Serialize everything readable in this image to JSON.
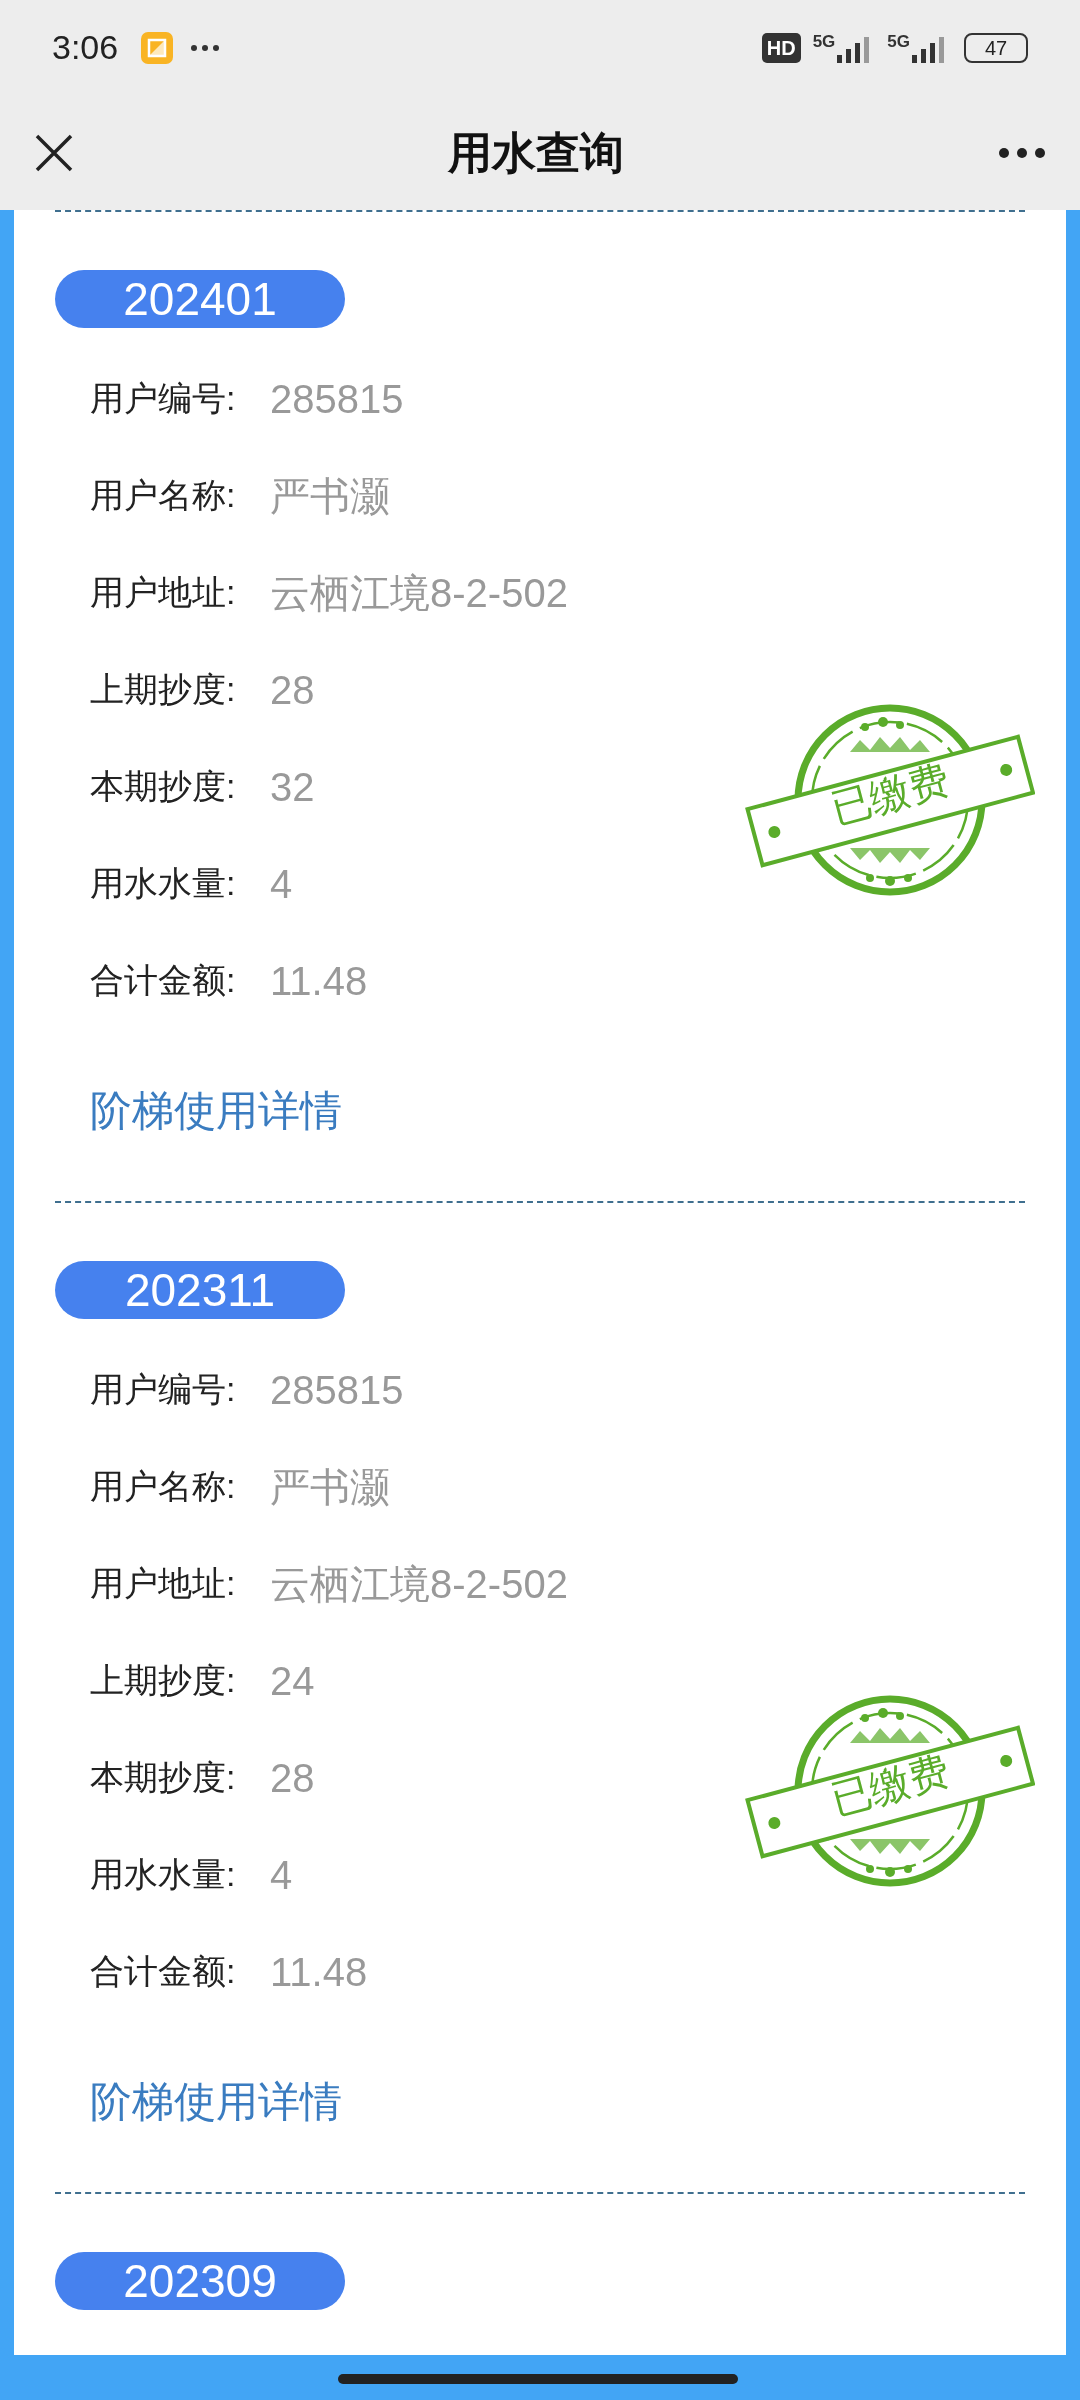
{
  "status_bar": {
    "time": "3:06",
    "hd": "HD",
    "networks": [
      "5G",
      "5G"
    ],
    "battery": "47"
  },
  "header": {
    "title": "用水查询"
  },
  "records": [
    {
      "period": "202401",
      "paid": true,
      "stamp": "已缴费",
      "fields": [
        {
          "label": "用户编号:",
          "value": "285815"
        },
        {
          "label": "用户名称:",
          "value": "严书灏"
        },
        {
          "label": "用户地址:",
          "value": "云栖江境8-2-502"
        },
        {
          "label": "上期抄度:",
          "value": "28"
        },
        {
          "label": "本期抄度:",
          "value": "32"
        },
        {
          "label": "用水水量:",
          "value": "4"
        },
        {
          "label": "合计金额:",
          "value": "11.48"
        }
      ],
      "link": "阶梯使用详情"
    },
    {
      "period": "202311",
      "paid": true,
      "stamp": "已缴费",
      "fields": [
        {
          "label": "用户编号:",
          "value": "285815"
        },
        {
          "label": "用户名称:",
          "value": "严书灏"
        },
        {
          "label": "用户地址:",
          "value": "云栖江境8-2-502"
        },
        {
          "label": "上期抄度:",
          "value": "24"
        },
        {
          "label": "本期抄度:",
          "value": "28"
        },
        {
          "label": "用水水量:",
          "value": "4"
        },
        {
          "label": "合计金额:",
          "value": "11.48"
        }
      ],
      "link": "阶梯使用详情"
    },
    {
      "period": "202309"
    }
  ]
}
